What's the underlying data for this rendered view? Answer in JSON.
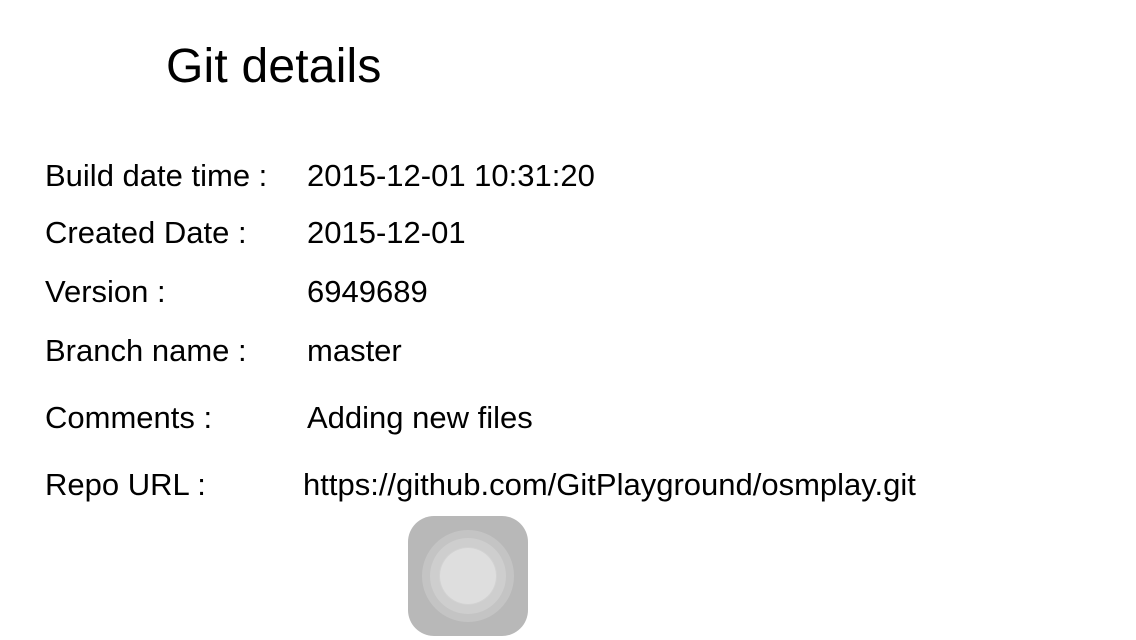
{
  "page": {
    "title": "Git details"
  },
  "details": {
    "build_date_time": {
      "label": "Build date time :",
      "value": "2015-12-01 10:31:20"
    },
    "created_date": {
      "label": "Created Date :",
      "value": "2015-12-01"
    },
    "version": {
      "label": "Version  :",
      "value": "6949689"
    },
    "branch_name": {
      "label": "Branch name :",
      "value": "master"
    },
    "comments": {
      "label": "Comments  :",
      "value": "Adding new files"
    },
    "repo_url": {
      "label": "Repo URL  :",
      "value": "https://github.com/GitPlayground/osmplay.git"
    }
  },
  "overlay": {
    "icon": "assistive-touch-icon"
  },
  "colors": {
    "background": "#ffffff",
    "text": "#000000",
    "assistive_touch": "#b8b8b8"
  }
}
